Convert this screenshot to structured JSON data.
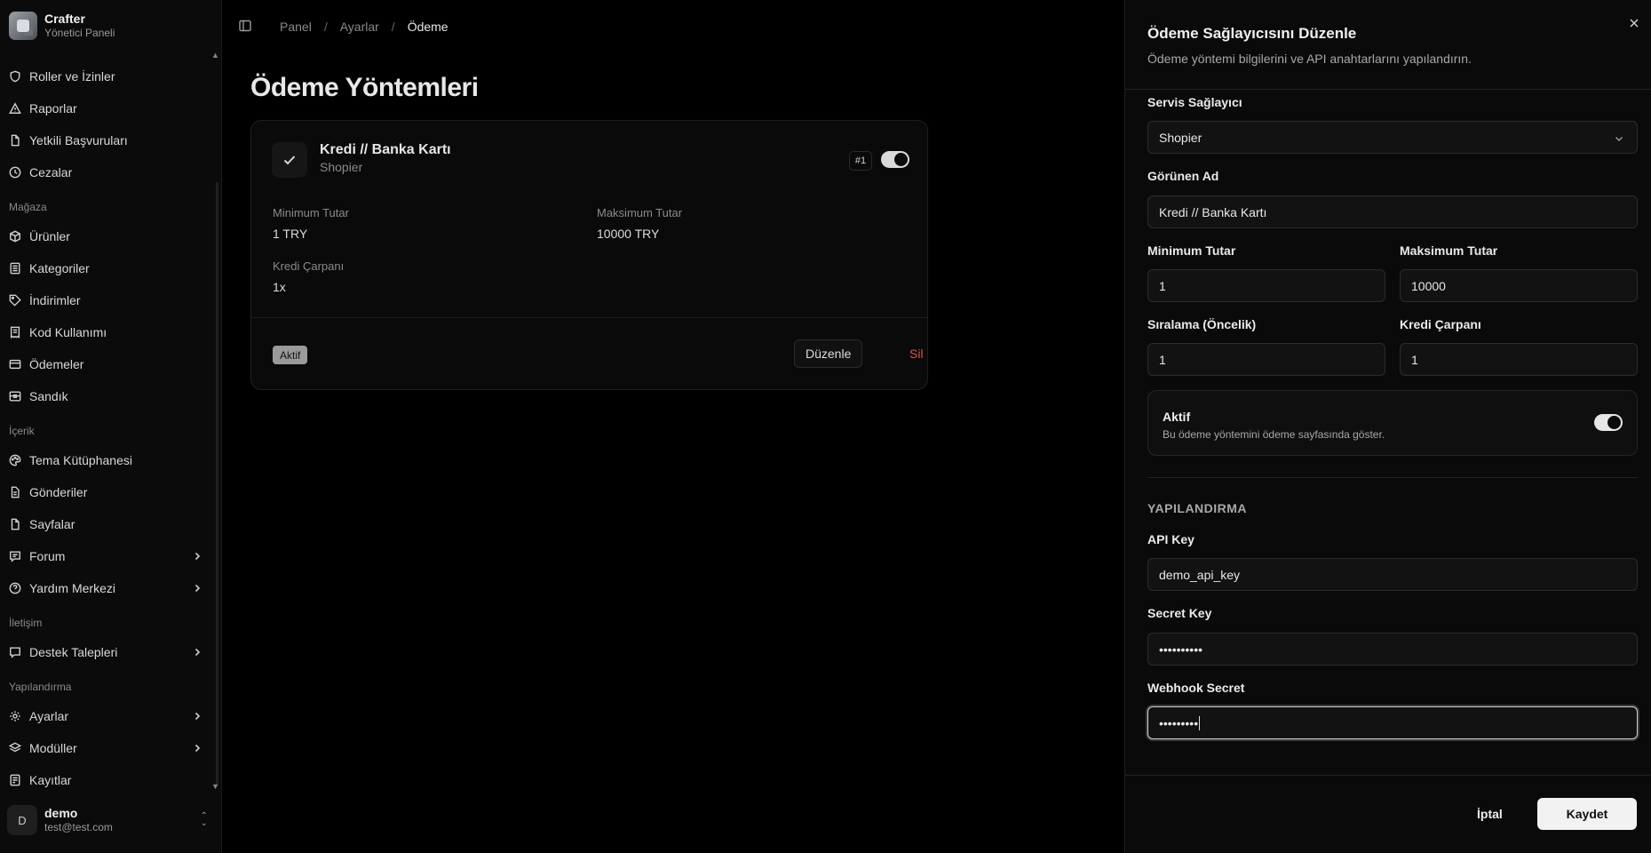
{
  "brand": {
    "name": "Crafter",
    "subtitle": "Yönetici Paneli"
  },
  "sidebar": {
    "items_top": [
      {
        "label": "Roller ve İzinler",
        "icon": "shield-icon"
      },
      {
        "label": "Raporlar",
        "icon": "warning-icon"
      },
      {
        "label": "Yetkili Başvuruları",
        "icon": "file-icon"
      },
      {
        "label": "Cezalar",
        "icon": "clock-icon"
      }
    ],
    "section_store": "Mağaza",
    "items_store": [
      {
        "label": "Ürünler",
        "icon": "box-icon"
      },
      {
        "label": "Kategoriler",
        "icon": "list-icon"
      },
      {
        "label": "İndirimler",
        "icon": "tag-icon"
      },
      {
        "label": "Kod Kullanımı",
        "icon": "receipt-icon"
      },
      {
        "label": "Ödemeler",
        "icon": "card-icon"
      },
      {
        "label": "Sandık",
        "icon": "chest-icon"
      }
    ],
    "section_content": "İçerik",
    "items_content": [
      {
        "label": "Tema Kütüphanesi",
        "icon": "palette-icon"
      },
      {
        "label": "Gönderiler",
        "icon": "document-icon"
      },
      {
        "label": "Sayfalar",
        "icon": "page-icon"
      },
      {
        "label": "Forum",
        "icon": "message-icon"
      },
      {
        "label": "Yardım Merkezi",
        "icon": "help-icon"
      }
    ],
    "section_comm": "İletişim",
    "items_comm": [
      {
        "label": "Destek Talepleri",
        "icon": "ticket-icon"
      }
    ],
    "section_config": "Yapılandırma",
    "items_config": [
      {
        "label": "Ayarlar",
        "icon": "gear-icon"
      },
      {
        "label": "Modüller",
        "icon": "layers-icon"
      },
      {
        "label": "Kayıtlar",
        "icon": "log-icon"
      }
    ]
  },
  "user": {
    "initial": "D",
    "name": "demo",
    "email": "test@test.com"
  },
  "breadcrumb": {
    "items": [
      "Panel",
      "Ayarlar",
      "Ödeme"
    ],
    "separator": "/"
  },
  "page": {
    "title": "Ödeme Yöntemleri"
  },
  "method_card": {
    "name": "Kredi // Banka Kartı",
    "provider": "Shopier",
    "order": "#1",
    "enabled": true,
    "min_label": "Minimum Tutar",
    "min_value": "1 TRY",
    "max_label": "Maksimum Tutar",
    "max_value": "10000 TRY",
    "multiplier_label": "Kredi Çarpanı",
    "multiplier_value": "1x",
    "status_badge": "Aktif",
    "edit_label": "Düzenle",
    "delete_label": "Sil"
  },
  "panel": {
    "title": "Ödeme Sağlayıcısını Düzenle",
    "description": "Ödeme yöntemi bilgilerini ve API anahtarlarını yapılandırın.",
    "provider_label": "Servis Sağlayıcı",
    "provider_value": "Shopier",
    "display_name_label": "Görünen Ad",
    "display_name_value": "Kredi // Banka Kartı",
    "min_label": "Minimum Tutar",
    "min_value": "1",
    "max_label": "Maksimum Tutar",
    "max_value": "10000",
    "order_label": "Sıralama (Öncelik)",
    "order_value": "1",
    "multiplier_label": "Kredi Çarpanı",
    "multiplier_value": "1",
    "active_title": "Aktif",
    "active_desc": "Bu ödeme yöntemini ödeme sayfasında göster.",
    "active_enabled": true,
    "config_title": "YAPILANDIRMA",
    "api_key_label": "API Key",
    "api_key_value": "demo_api_key",
    "secret_key_label": "Secret Key",
    "secret_key_value": "••••••••••",
    "webhook_label": "Webhook Secret",
    "webhook_value": "•••••••••",
    "cancel_label": "İptal",
    "save_label": "Kaydet"
  },
  "colors": {
    "accent": "#f2f2f2",
    "danger": "#d9534f",
    "background": "#000000",
    "panel": "#0a0a0a"
  }
}
